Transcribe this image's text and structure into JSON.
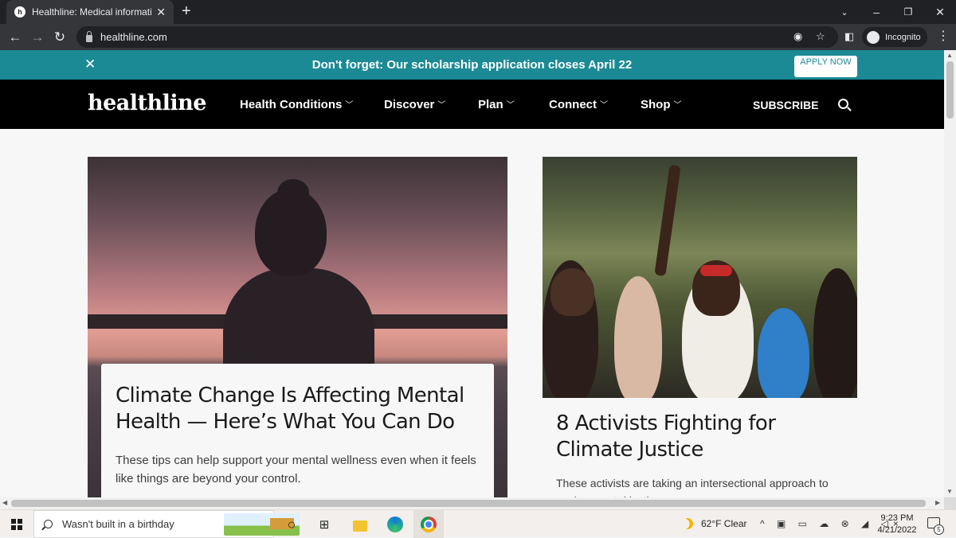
{
  "browser": {
    "tab_title": "Healthline: Medical information a",
    "tab_favicon": "healthline-favicon-icon",
    "new_tab_label": "+",
    "url": "healthline.com",
    "incognito_label": "Incognito"
  },
  "banner": {
    "message": "Don't forget: Our scholarship application closes April 22",
    "apply_label": "APPLY NOW",
    "background_color": "#1b8a95"
  },
  "site_nav": {
    "logo": "healthline",
    "items": [
      {
        "label": "Health Conditions"
      },
      {
        "label": "Discover"
      },
      {
        "label": "Plan"
      },
      {
        "label": "Connect"
      },
      {
        "label": "Shop"
      }
    ],
    "subscribe_label": "SUBSCRIBE"
  },
  "articles": [
    {
      "headline": "Climate Change Is Affecting Mental Health — Here’s What You Can Do",
      "dek": "These tips can help support your mental wellness even when it feels like things are beyond your control."
    },
    {
      "headline": "8 Activists Fighting for Climate Justice",
      "dek": "These activists are taking an intersectional approach to environmental justice."
    }
  ],
  "taskbar": {
    "search_text": "Wasn't built in a birthday",
    "weather": "62°F  Clear",
    "time": "9:23 PM",
    "date": "4/21/2022",
    "notification_count": "5"
  }
}
